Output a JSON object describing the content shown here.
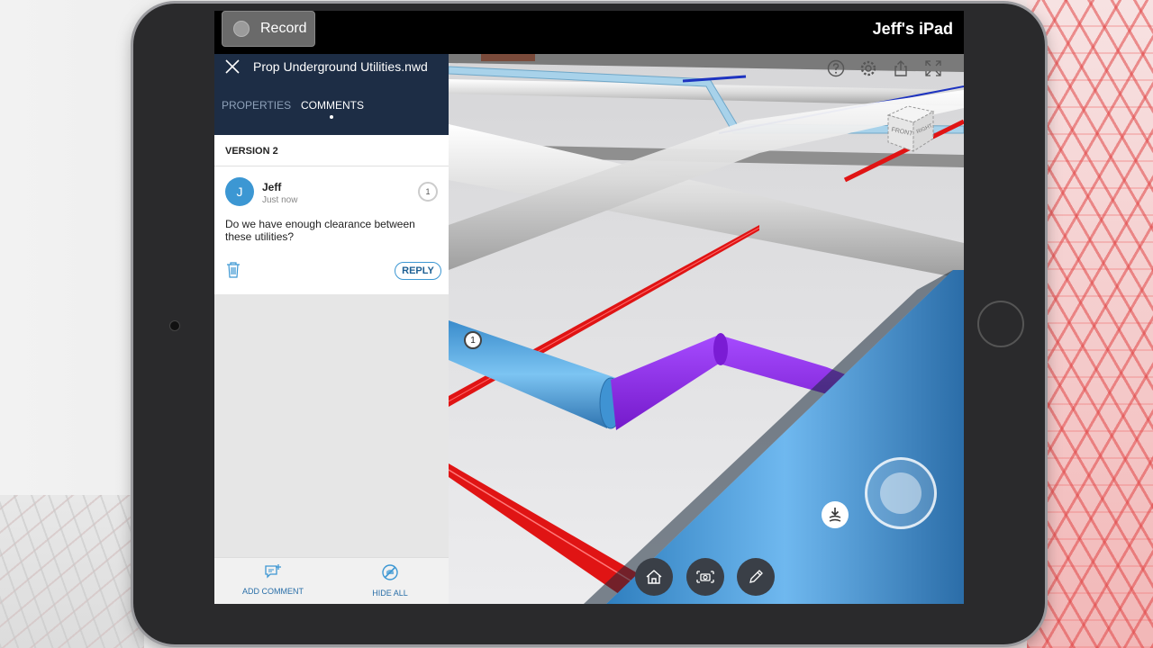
{
  "recording": {
    "label": "Record"
  },
  "device": {
    "name": "Jeff's iPad"
  },
  "panel": {
    "file_title": "Prop Underground Utilities.nwd",
    "tabs": [
      {
        "label": "PROPERTIES",
        "active": false
      },
      {
        "label": "COMMENTS",
        "active": true
      }
    ],
    "version_label": "VERSION 2",
    "comment": {
      "avatar_initial": "J",
      "author": "Jeff",
      "time": "Just now",
      "count": "1",
      "text": "Do we have enough clearance between these utilities?",
      "reply_label": "REPLY"
    },
    "footer": {
      "add_comment": "ADD COMMENT",
      "hide_all": "HIDE ALL"
    }
  },
  "viewport": {
    "pin_marker": "1",
    "top_icons": [
      "help-icon",
      "settings-icon",
      "share-icon",
      "fullscreen-icon"
    ],
    "nav_cube": {
      "front": "FRONT",
      "right": "RIGHT"
    },
    "tools": [
      "home-icon",
      "camera-icon",
      "markup-pen-icon"
    ]
  },
  "colors": {
    "panel_header": "#1d2d45",
    "accent_blue": "#3c97d3",
    "pipe_red": "#e01414",
    "pipe_purple": "#8a1ee6",
    "pipe_blue": "#5ba7e0"
  }
}
